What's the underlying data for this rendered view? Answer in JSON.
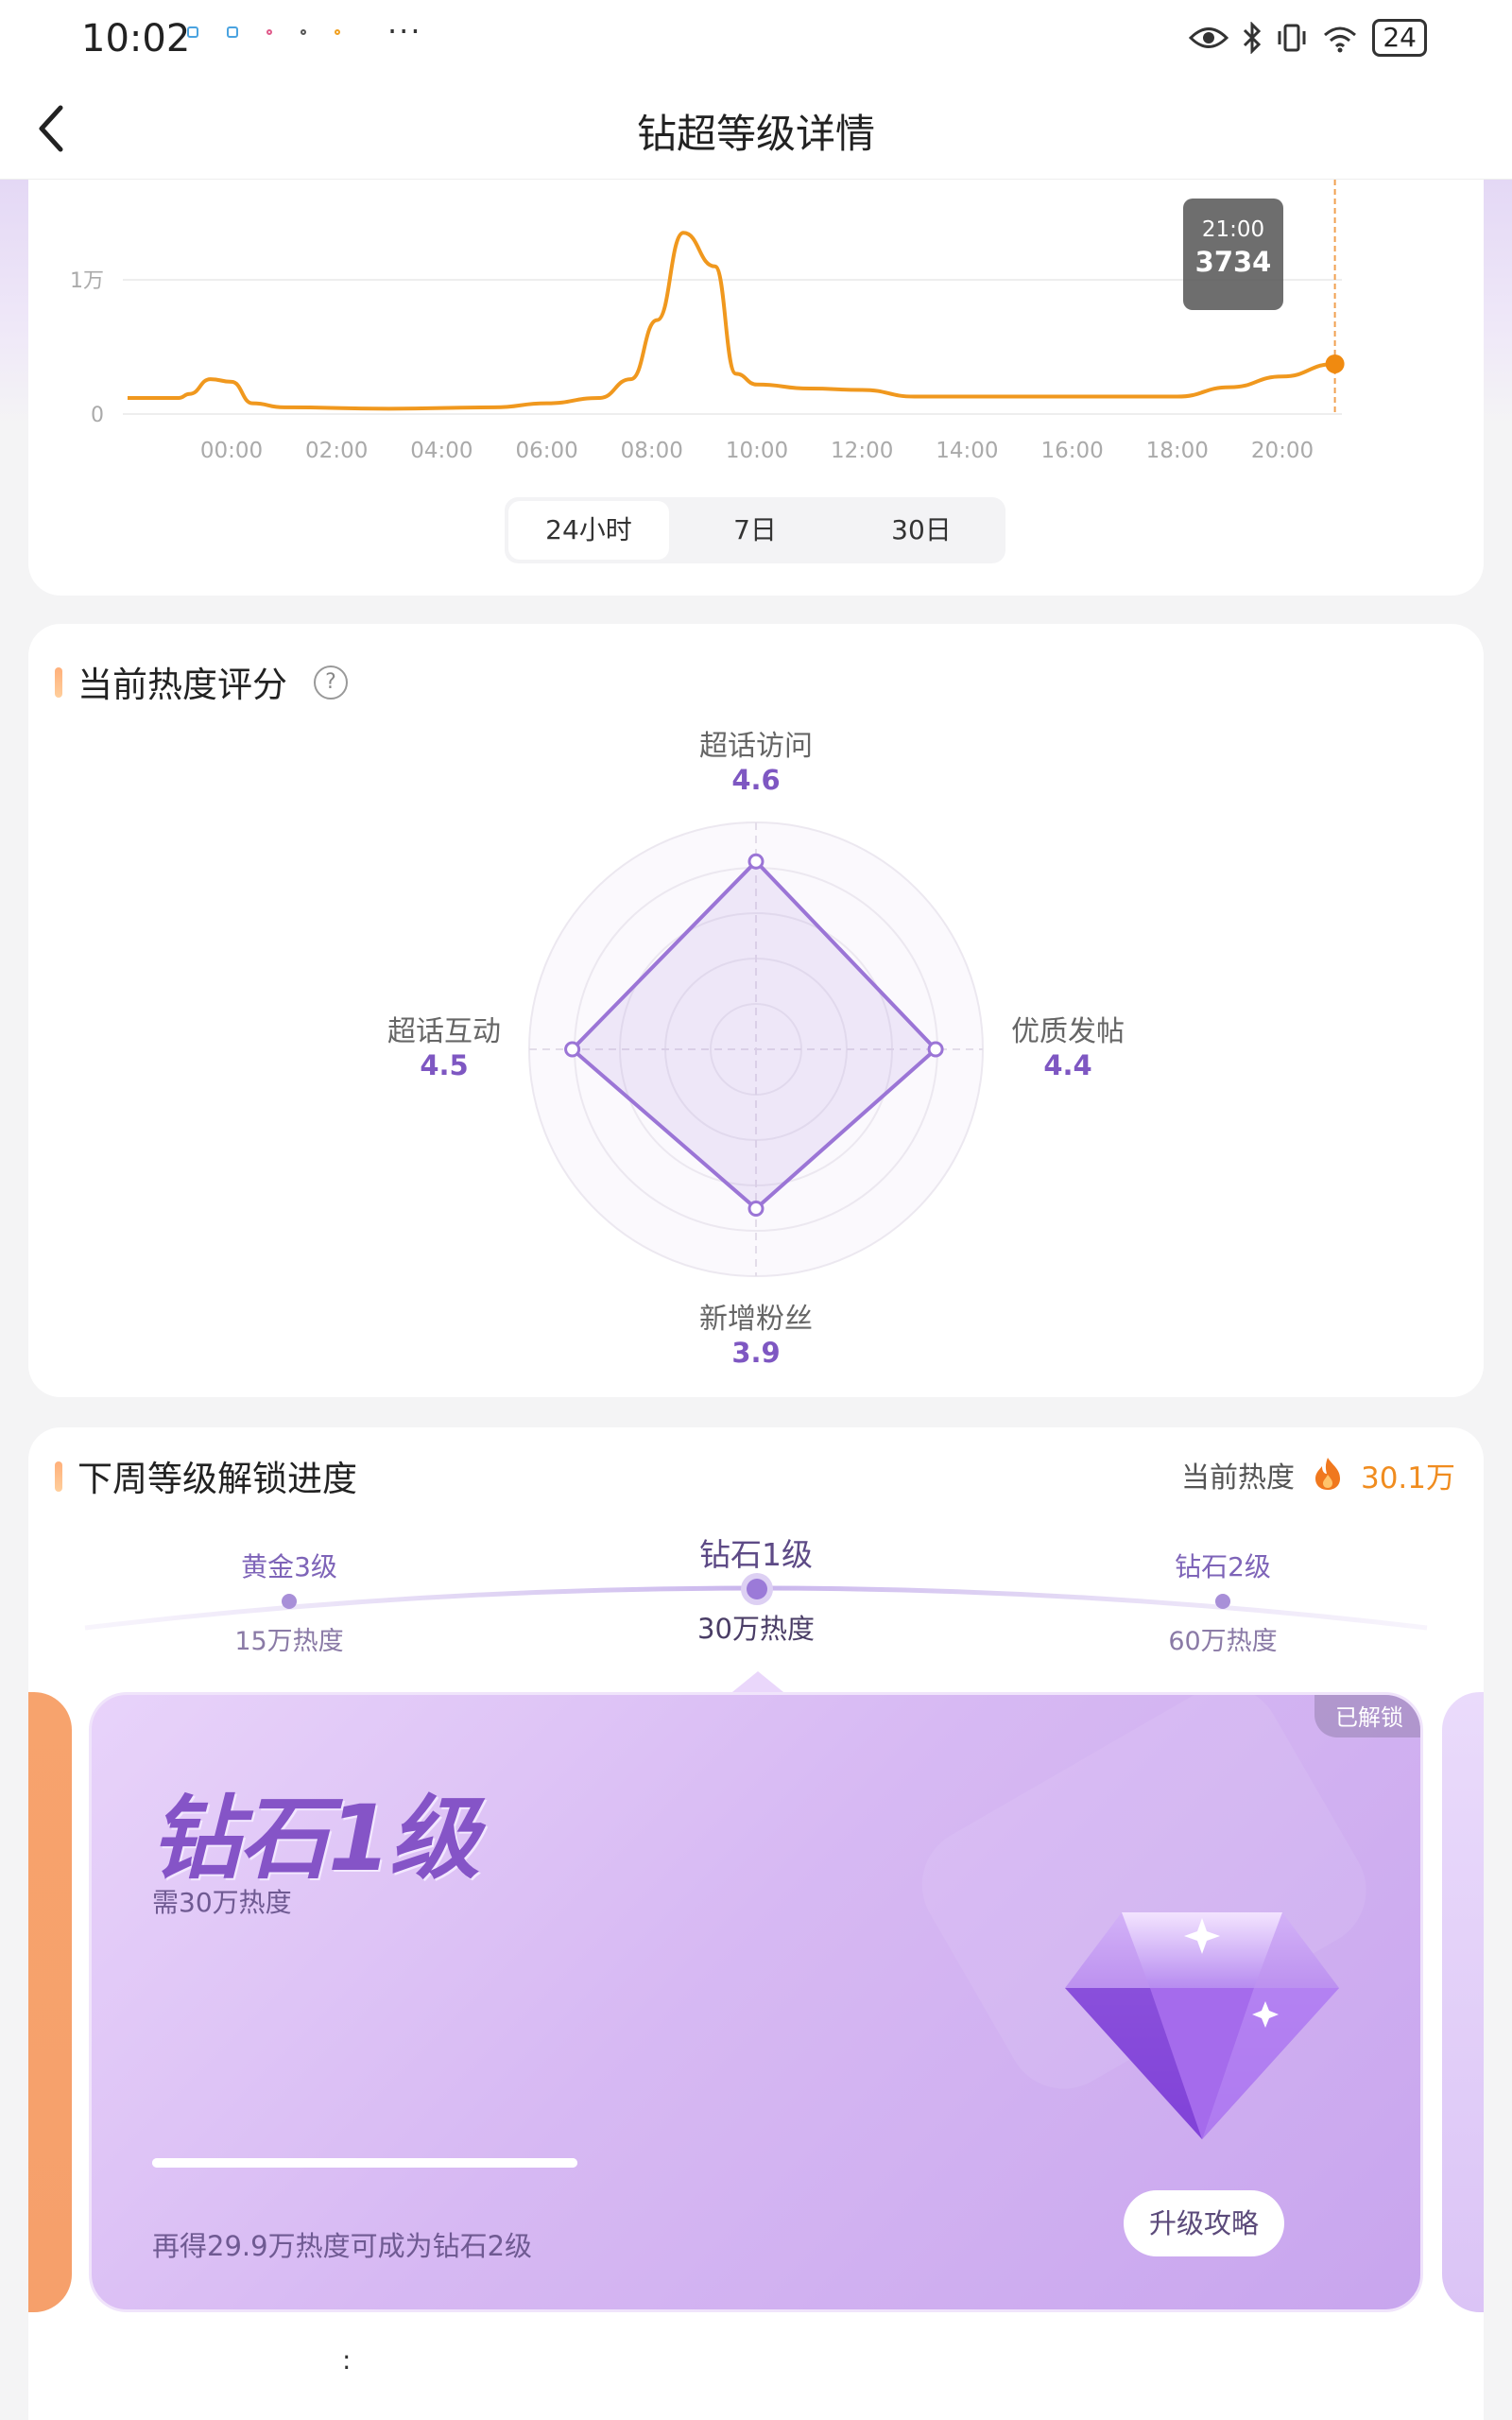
{
  "status_bar": {
    "time": "10:02",
    "more": "···",
    "battery": "24"
  },
  "nav": {
    "title": "钻超等级详情"
  },
  "chart_data": {
    "type": "line",
    "x": [
      "00:00",
      "02:00",
      "04:00",
      "06:00",
      "08:00",
      "10:00",
      "12:00",
      "14:00",
      "16:00",
      "18:00",
      "20:00"
    ],
    "y_ticks": [
      "0",
      "1万"
    ],
    "ylim": [
      0,
      13000
    ],
    "points": [
      [
        -2,
        1200
      ],
      [
        -1,
        1200
      ],
      [
        -0.8,
        1500
      ],
      [
        -0.4,
        2600
      ],
      [
        0,
        2400
      ],
      [
        0.4,
        800
      ],
      [
        1,
        500
      ],
      [
        3,
        400
      ],
      [
        5,
        500
      ],
      [
        6,
        800
      ],
      [
        7,
        1200
      ],
      [
        7.6,
        2600
      ],
      [
        8.1,
        7000
      ],
      [
        8.6,
        13500
      ],
      [
        9.2,
        11000
      ],
      [
        9.6,
        3000
      ],
      [
        10,
        2200
      ],
      [
        11,
        1900
      ],
      [
        12,
        1800
      ],
      [
        13,
        1300
      ],
      [
        14,
        1300
      ],
      [
        16,
        1300
      ],
      [
        18,
        1300
      ],
      [
        19,
        2000
      ],
      [
        20,
        2800
      ],
      [
        21,
        3734
      ]
    ],
    "tooltip": {
      "time": "21:00",
      "value": "3734"
    }
  },
  "range_tabs": [
    {
      "label": "24小时",
      "active": true
    },
    {
      "label": "7日",
      "active": false
    },
    {
      "label": "30日",
      "active": false
    }
  ],
  "score_section": {
    "title": "当前热度评分",
    "radar": {
      "axes": [
        {
          "name": "超话访问",
          "value": 4.6,
          "value_label": "4.6"
        },
        {
          "name": "优质发帖",
          "value": 4.4,
          "value_label": "4.4"
        },
        {
          "name": "新增粉丝",
          "value": 3.9,
          "value_label": "3.9"
        },
        {
          "name": "超话互动",
          "value": 4.5,
          "value_label": "4.5"
        }
      ],
      "max": 5
    }
  },
  "level_section": {
    "title": "下周等级解锁进度",
    "heat_label": "当前热度",
    "heat_value": "30.1万",
    "levels": [
      {
        "name": "黄金3级",
        "req": "15万热度"
      },
      {
        "name": "钻石1级",
        "req": "30万热度",
        "current": true
      },
      {
        "name": "钻石2级",
        "req": "60万热度"
      }
    ],
    "card": {
      "badge": "已解锁",
      "title": "钻石1级",
      "need": "需30万热度",
      "progress": 1.0,
      "hint": "再得29.9万热度可成为钻石2级",
      "button": "升级攻略"
    },
    "colon": ":"
  }
}
